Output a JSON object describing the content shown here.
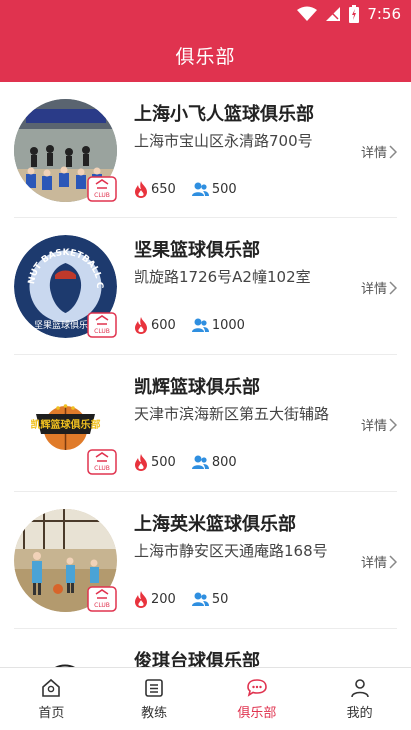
{
  "status_bar": {
    "time": "7:56",
    "icons": [
      "wifi-icon",
      "signal-icon",
      "battery-charging-icon"
    ]
  },
  "header": {
    "title": "俱乐部"
  },
  "detail_label": "详情",
  "clubs": [
    {
      "name": "上海小飞人篮球俱乐部",
      "address": "上海市宝山区永清路700号",
      "popularity": "650",
      "members": "500"
    },
    {
      "name": "坚果篮球俱乐部",
      "address": "凯旋路1726号A2幢102室",
      "popularity": "600",
      "members": "1000"
    },
    {
      "name": "凯辉篮球俱乐部",
      "address": "天津市滨海新区第五大街辅路",
      "popularity": "500",
      "members": "800"
    },
    {
      "name": "上海英米篮球俱乐部",
      "address": "上海市静安区天通庵路168号",
      "popularity": "200",
      "members": "50"
    },
    {
      "name": "俊琪台球俱乐部",
      "address": "",
      "popularity": "",
      "members": ""
    }
  ],
  "logo_text": {
    "nut_ring": "NUT BASKETBALL CLUB",
    "nut_cn": "坚果篮球俱乐部",
    "kaihui": "凯辉篮球俱乐部"
  },
  "badge_text": "CLUB",
  "tabs": [
    {
      "label": "首页",
      "icon": "home-icon",
      "active": false
    },
    {
      "label": "教练",
      "icon": "list-icon",
      "active": false
    },
    {
      "label": "俱乐部",
      "icon": "chat-icon",
      "active": true
    },
    {
      "label": "我的",
      "icon": "user-icon",
      "active": false
    }
  ],
  "colors": {
    "primary": "#e0334f",
    "flame": "#e8333d",
    "members": "#2f8fe0"
  }
}
